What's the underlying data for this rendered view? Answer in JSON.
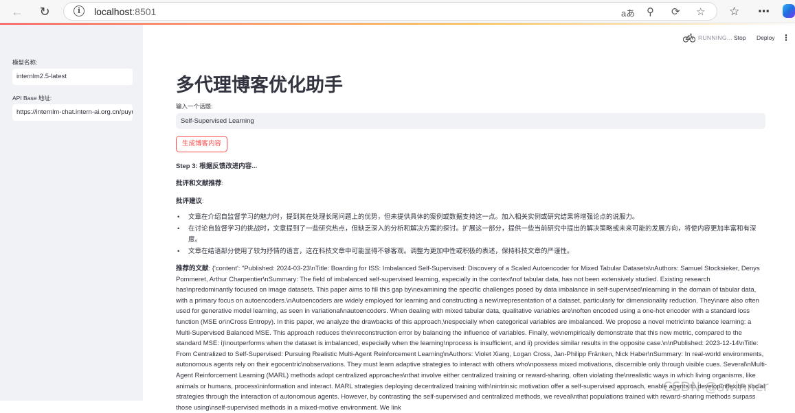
{
  "browser": {
    "url_host": "localhost",
    "url_port": ":8501",
    "icons": [
      "back-icon",
      "refresh-icon",
      "info-icon",
      "read-aloud-icon",
      "zoom-out-icon",
      "browser-essentials-icon",
      "favorite-star-icon",
      "favorites-icon",
      "more-icon",
      "copilot-icon"
    ]
  },
  "sidebar": {
    "model_label": "模型名称:",
    "model_value": "internlm2.5-latest",
    "api_label": "API Base 地址:",
    "api_value": "https://internlm-chat.intern-ai.org.cn/puyu/api/v1/"
  },
  "header": {
    "status": "RUNNING...",
    "stop_label": "Stop",
    "deploy_label": "Deploy"
  },
  "main": {
    "title": "多代理博客优化助手",
    "topic_label": "输入一个话题:",
    "topic_value": "Self-Supervised Learning",
    "generate_label": "生成博客内容",
    "step_text": "Step 3: 根据反馈改进内容...",
    "critique_heading": "批评和文献推荐",
    "critique_colon": ":",
    "suggestions_heading": "批评建议",
    "suggestions_colon": ":",
    "suggestions": [
      "文章在介绍自监督学习的魅力时，提到其在处理长尾问题上的优势，但未提供具体的案例或数据支持这一点。加入相关实例或研究结果将增强论点的说服力。",
      "在讨论自监督学习的挑战时，文章提到了一些研究热点，但缺乏深入的分析和解决方案的探讨。扩展这一部分，提供一些当前研究中提出的解决策略或未来可能的发展方向，将使内容更加丰富和有深度。",
      "文章在结语部分使用了较为抒情的语言，这在科技文章中可能显得不够客观。调整为更加中性或积极的表述，保持科技文章的严谨性。"
    ],
    "refs_label": "推荐的文献",
    "refs_text": ": {'content': \"Published: 2024-03-23\\nTitle: Boarding for ISS: Imbalanced Self-Supervised: Discovery of a Scaled Autoencoder for Mixed Tabular Datasets\\nAuthors: Samuel Stocksieker, Denys Pommeret, Arthur Charpentier\\nSummary: The field of imbalanced self-supervised learning, especially in the context\\nof tabular data, has not been extensively studied. Existing research has\\npredominantly focused on image datasets. This paper aims to fill this gap by\\nexamining the specific challenges posed by data imbalance in self-supervised\\nlearning in the domain of tabular data, with a primary focus on autoencoders.\\nAutoencoders are widely employed for learning and constructing a new\\nrepresentation of a dataset, particularly for dimensionality reduction. They\\nare also often used for generative model learning, as seen in variational\\nautoencoders. When dealing with mixed tabular data, qualitative variables are\\noften encoded using a one-hot encoder with a standard loss function (MSE or\\nCross Entropy). In this paper, we analyze the drawbacks of this approach,\\nespecially when categorical variables are imbalanced. We propose a novel metric\\nto balance learning: a Multi-Supervised Balanced MSE. This approach reduces the\\nreconstruction error by balancing the influence of variables. Finally, we\\nempirically demonstrate that this new metric, compared to the standard MSE: i)\\noutperforms when the dataset is imbalanced, especially when the learning\\nprocess is insufficient, and ii) provides similar results in the opposite case.\\n\\nPublished: 2023-12-14\\nTitle: From Centralized to Self-Supervised: Pursuing Realistic Multi-Agent Reinforcement Learning\\nAuthors: Violet Xiang, Logan Cross, Jan-Philipp Fränken, Nick Haber\\nSummary: In real-world environments, autonomous agents rely on their egocentric\\nobservations. They must learn adaptive strategies to interact with others who\\npossess mixed motivations, discernible only through visible cues. Several\\nMulti-Agent Reinforcement Learning (MARL) methods adopt centralized approaches\\nthat involve either centralized training or reward-sharing, often violating the\\nrealistic ways in which living organisms, like animals or humans, process\\ninformation and interact. MARL strategies deploying decentralized training with\\nintrinsic motivation offer a self-supervised approach, enable agents to develop\\nflexible social strategies through the interaction of autonomous agents. However, by contrasting the self-supervised and centralized methods, we reveal\\nthat populations trained with reward-sharing methods surpass those using\\nself-supervised methods in a mixed-motive environment. We link"
  },
  "watermark": "CSDN @swinner"
}
